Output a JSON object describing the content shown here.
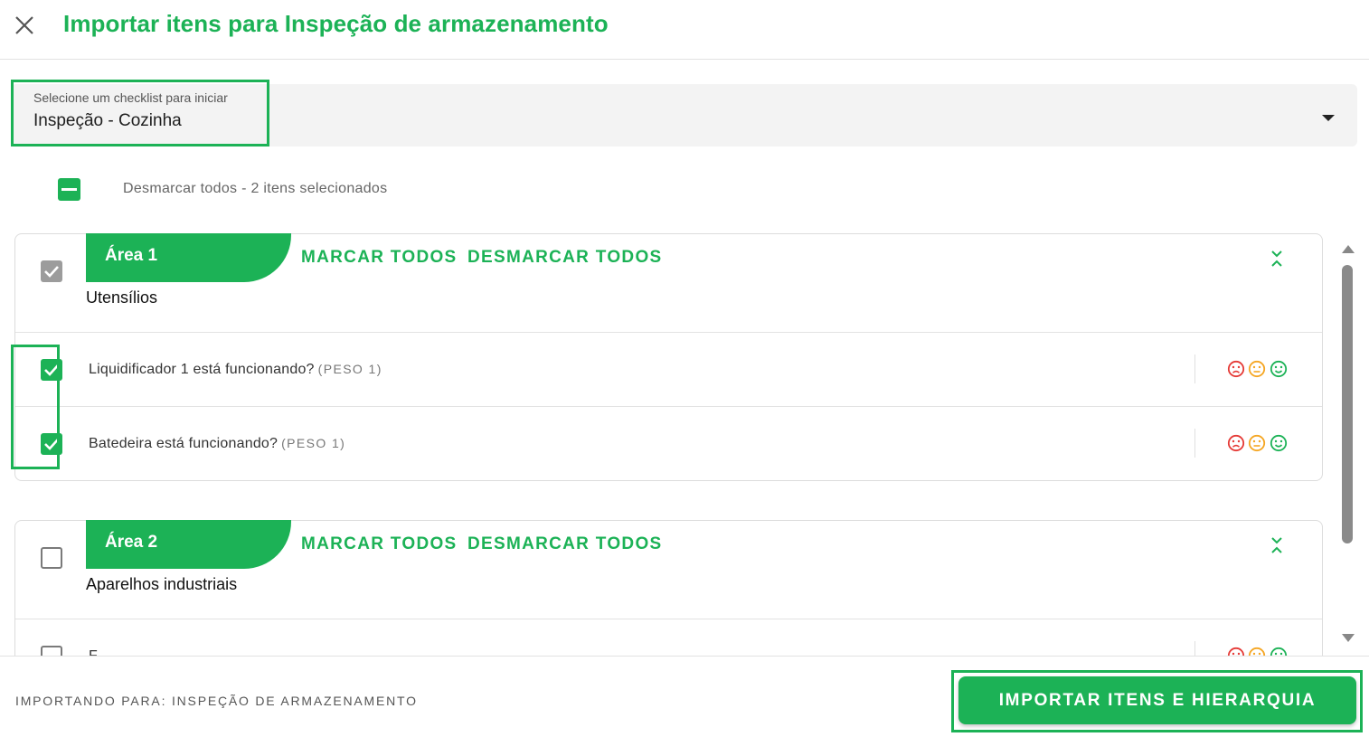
{
  "header": {
    "close_icon": "close-icon",
    "title": "Importar itens para Inspeção de armazenamento"
  },
  "checklist_select": {
    "label": "Selecione um checklist para iniciar",
    "value": "Inspeção - Cozinha",
    "caret_icon": "caret-down-icon"
  },
  "selection": {
    "master_state": "indeterminate",
    "text": "Desmarcar todos - 2 itens selecionados"
  },
  "areas": [
    {
      "tag": "Área 1",
      "group_name": "Utensílios",
      "group_checked": true,
      "mark_all_label": "MARCAR TODOS",
      "unmark_all_label": "DESMARCAR TODOS",
      "collapse_icon": "collapse-icon",
      "items": [
        {
          "question": "Liquidificador 1 está funcionando?",
          "peso": "(PESO 1)",
          "checked": true
        },
        {
          "question": "Batedeira está funcionando?",
          "peso": "(PESO 1)",
          "checked": true
        }
      ]
    },
    {
      "tag": "Área 2",
      "group_name": "Aparelhos industriais",
      "group_checked": false,
      "mark_all_label": "MARCAR TODOS",
      "unmark_all_label": "DESMARCAR TODOS",
      "collapse_icon": "collapse-icon",
      "items": [
        {
          "question": "F",
          "peso": "",
          "checked": false
        }
      ]
    }
  ],
  "rating_icons": [
    "sad-face-icon",
    "neutral-face-icon",
    "happy-face-icon"
  ],
  "colors": {
    "accent": "#1cb256",
    "sad": "#e53935",
    "neutral": "#f5a623",
    "happy": "#1cb256"
  },
  "footer": {
    "importing_to": "IMPORTANDO PARA: INSPEÇÃO DE ARMAZENAMENTO",
    "import_button": "IMPORTAR ITENS E HIERARQUIA"
  }
}
